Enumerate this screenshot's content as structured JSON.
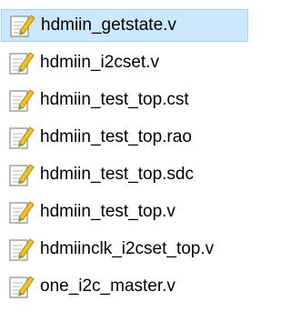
{
  "file_list": {
    "items": [
      {
        "name": "hdmiin_getstate.v",
        "icon": "text-file-pencil-icon",
        "selected": true
      },
      {
        "name": "hdmiin_i2cset.v",
        "icon": "text-file-pencil-icon",
        "selected": false
      },
      {
        "name": "hdmiin_test_top.cst",
        "icon": "text-file-pencil-icon",
        "selected": false
      },
      {
        "name": "hdmiin_test_top.rao",
        "icon": "text-file-pencil-icon",
        "selected": false
      },
      {
        "name": "hdmiin_test_top.sdc",
        "icon": "text-file-pencil-icon",
        "selected": false
      },
      {
        "name": "hdmiin_test_top.v",
        "icon": "text-file-pencil-icon",
        "selected": false
      },
      {
        "name": "hdmiinclk_i2cset_top.v",
        "icon": "text-file-pencil-icon",
        "selected": false
      },
      {
        "name": "one_i2c_master.v",
        "icon": "text-file-pencil-icon",
        "selected": false
      }
    ]
  },
  "colors": {
    "selection_fill": "#cce8ff",
    "selection_border": "#99d1ff",
    "pencil_yellow": "#f4c21b",
    "pencil_green": "#6aa84f"
  }
}
